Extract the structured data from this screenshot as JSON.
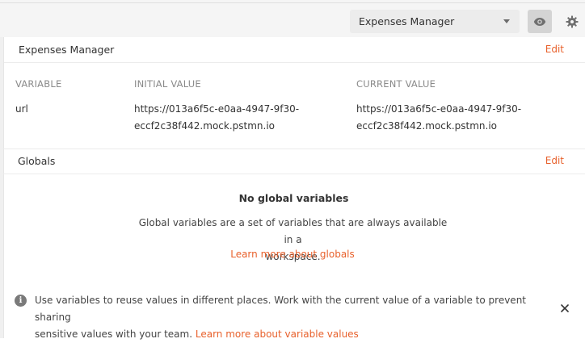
{
  "header": {
    "environment_selected": "Expenses Manager",
    "eye_icon": "eye-icon",
    "gear_icon": "gear-icon"
  },
  "environment": {
    "title": "Expenses Manager",
    "edit_label": "Edit",
    "columns": {
      "variable": "VARIABLE",
      "initial": "INITIAL VALUE",
      "current": "CURRENT VALUE"
    },
    "rows": [
      {
        "variable": "url",
        "initial_line1": "https://013a6f5c-e0aa-4947-9f30-",
        "initial_line2": "eccf2c38f442.mock.pstmn.io",
        "current_line1": "https://013a6f5c-e0aa-4947-9f30-",
        "current_line2": "eccf2c38f442.mock.pstmn.io"
      }
    ]
  },
  "globals": {
    "title": "Globals",
    "edit_label": "Edit",
    "empty_title": "No global variables",
    "empty_desc_line1": "Global variables are a set of variables that are always available in a",
    "empty_desc_line2": "workspace.",
    "learn_more": "Learn more about globals"
  },
  "info": {
    "icon": "info-icon",
    "icon_glyph": "i",
    "text_line1": "Use variables to reuse values in different places. Work with the current value of a variable to prevent sharing",
    "text_line2_prefix": "sensitive values with your team.",
    "link": "Learn more about variable values",
    "close_icon": "close-icon"
  },
  "colors": {
    "accent": "#e8612c",
    "topbar_bg": "#f5f5f5",
    "select_bg": "#ececec",
    "eye_button_bg": "#d4d4d4"
  }
}
